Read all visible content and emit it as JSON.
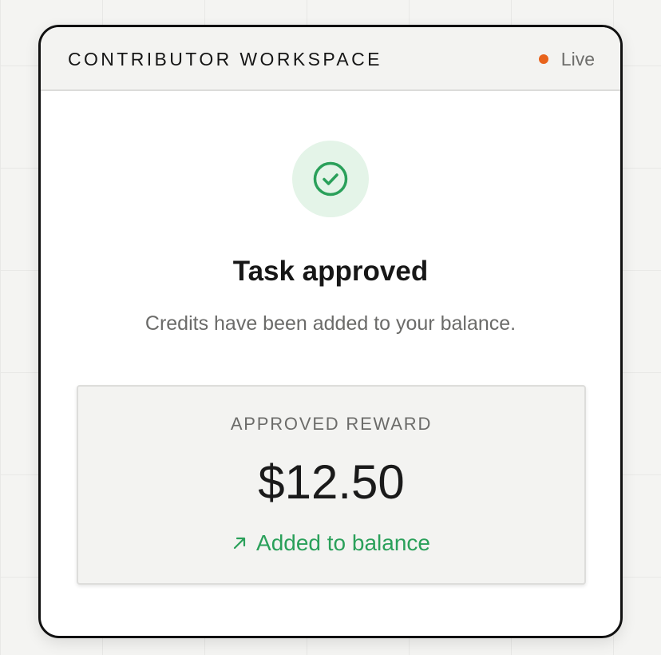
{
  "header": {
    "title": "CONTRIBUTOR WORKSPACE",
    "status_label": "Live"
  },
  "result": {
    "icon": "check-circle-icon",
    "title": "Task approved",
    "message": "Credits have been added to your balance."
  },
  "reward": {
    "label": "APPROVED REWARD",
    "amount": "$12.50",
    "status_icon": "arrow-up-right-icon",
    "status_text": "Added to balance"
  },
  "colors": {
    "live_dot": "#e8631c",
    "success": "#2aa05a",
    "success_bg": "#e4f4e8"
  }
}
